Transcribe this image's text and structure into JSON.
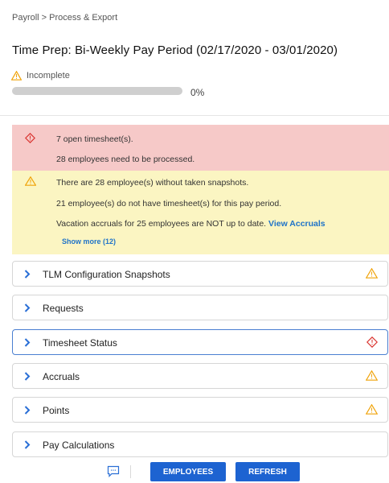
{
  "breadcrumb": "Payroll > Process & Export",
  "title": "Time Prep: Bi-Weekly Pay Period (02/17/2020 - 03/01/2020)",
  "status": {
    "label": "Incomplete",
    "progress_percent": 0,
    "progress_label": "0%",
    "icon": "warning-icon"
  },
  "colors": {
    "error_bg": "#f6c9c8",
    "warning_bg": "#fbf5c2",
    "error_icon": "#d9322e",
    "warning_icon": "#f0a30a",
    "primary_button": "#1d63d1",
    "link": "#1f73c8"
  },
  "alerts": {
    "error": {
      "icon": "error-diamond-icon",
      "lines": [
        "7 open timesheet(s).",
        "28 employees need to be processed."
      ]
    },
    "warning": {
      "icon": "warning-icon",
      "lines": [
        "There are 28 employee(s) without taken snapshots.",
        "21 employee(s) do not have timesheet(s) for this pay period.",
        "Vacation accruals for 25 employees are NOT up to date."
      ],
      "link_label": "View Accruals",
      "show_more": "Show more (12)"
    }
  },
  "sections": [
    {
      "label": "TLM Configuration Snapshots",
      "icon": "warning-icon"
    },
    {
      "label": "Requests",
      "icon": ""
    },
    {
      "label": "Timesheet Status",
      "icon": "error-diamond-icon"
    },
    {
      "label": "Accruals",
      "icon": "warning-icon"
    },
    {
      "label": "Points",
      "icon": "warning-icon"
    },
    {
      "label": "Pay Calculations",
      "icon": ""
    }
  ],
  "buttons": {
    "employees": "EMPLOYEES",
    "refresh": "REFRESH",
    "comment_icon": "comment-icon"
  }
}
